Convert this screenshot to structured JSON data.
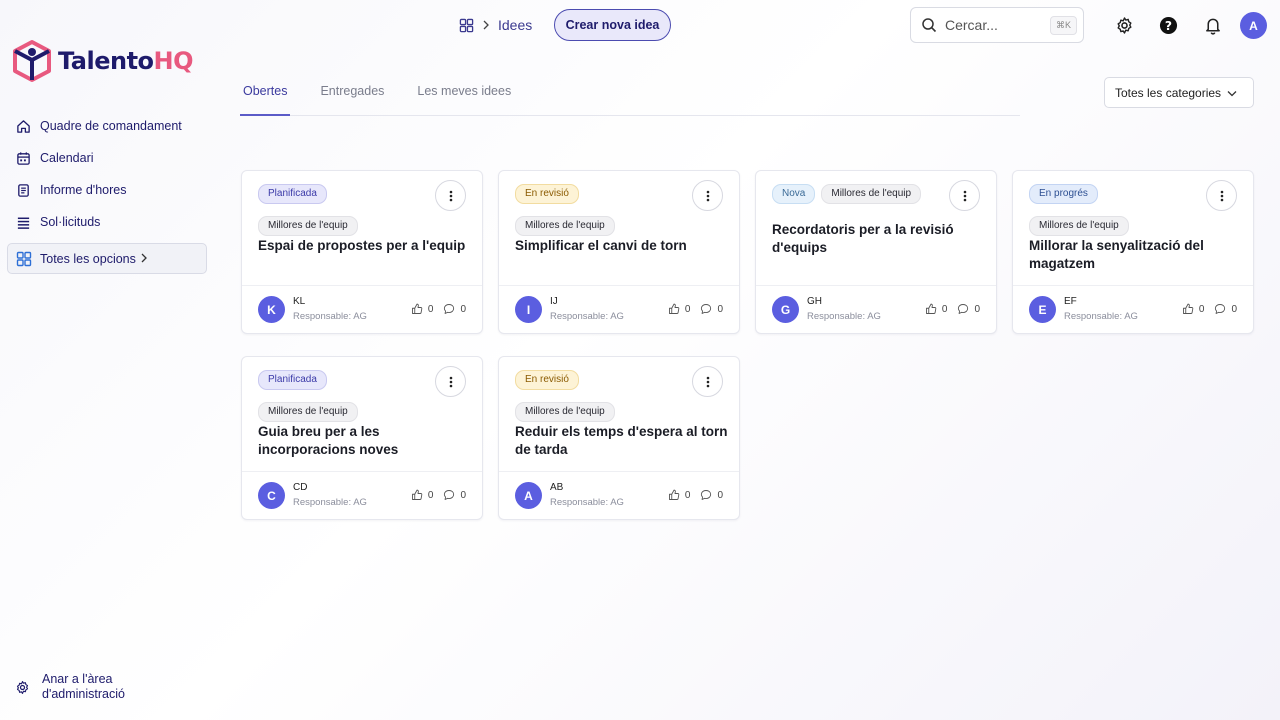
{
  "brand": {
    "name_part1": "Talento",
    "name_part2": "HQ",
    "primary_color": "#1e1b6b",
    "accent_color": "#e8597f"
  },
  "sidebar": {
    "items": [
      {
        "label": "Quadre de comandament",
        "icon": "home-icon"
      },
      {
        "label": "Calendari",
        "icon": "calendar-icon"
      },
      {
        "label": "Informe d'hores",
        "icon": "report-icon"
      },
      {
        "label": "Sol·licituds",
        "icon": "list-icon"
      }
    ],
    "all_options": "Totes les opcions",
    "admin": "Anar a l'àrea d'administració"
  },
  "header": {
    "breadcrumb": "Idees",
    "new_button": "Crear nova idea",
    "search_placeholder": "Cercar...",
    "search_shortcut": "⌘K",
    "user_initial": "A"
  },
  "tabs": [
    {
      "label": "Obertes",
      "active": true
    },
    {
      "label": "Entregades",
      "active": false
    },
    {
      "label": "Les meves idees",
      "active": false
    }
  ],
  "category_filter": "Totes les categories",
  "cards": [
    {
      "status": "Planificada",
      "status_type": "planned",
      "category": "Millores de l'equip",
      "title": "Espai de propostes per a l'equip",
      "initial": "K",
      "author": "KL",
      "responsible": "Responsable: AG",
      "likes": "0",
      "comments": "0"
    },
    {
      "status": "En revisió",
      "status_type": "review",
      "category": "Millores de l'equip",
      "title": "Simplificar el canvi de torn",
      "initial": "I",
      "author": "IJ",
      "responsible": "Responsable: AG",
      "likes": "0",
      "comments": "0"
    },
    {
      "status": "Nova",
      "status_type": "new",
      "category": "Millores de l'equip",
      "title": "Recordatoris per a la revisió d'equips",
      "initial": "G",
      "author": "GH",
      "responsible": "Responsable: AG",
      "likes": "0",
      "comments": "0"
    },
    {
      "status": "En progrés",
      "status_type": "progress",
      "category": "Millores de l'equip",
      "title": "Millorar la senyalització del magatzem",
      "initial": "E",
      "author": "EF",
      "responsible": "Responsable: AG",
      "likes": "0",
      "comments": "0"
    },
    {
      "status": "Planificada",
      "status_type": "planned",
      "category": "Millores de l'equip",
      "title": "Guia breu per a les incorporacions noves",
      "initial": "C",
      "author": "CD",
      "responsible": "Responsable: AG",
      "likes": "0",
      "comments": "0"
    },
    {
      "status": "En revisió",
      "status_type": "review",
      "category": "Millores de l'equip",
      "title": "Reduir els temps d'espera al torn de tarda",
      "initial": "A",
      "author": "AB",
      "responsible": "Responsable: AG",
      "likes": "0",
      "comments": "0"
    }
  ]
}
